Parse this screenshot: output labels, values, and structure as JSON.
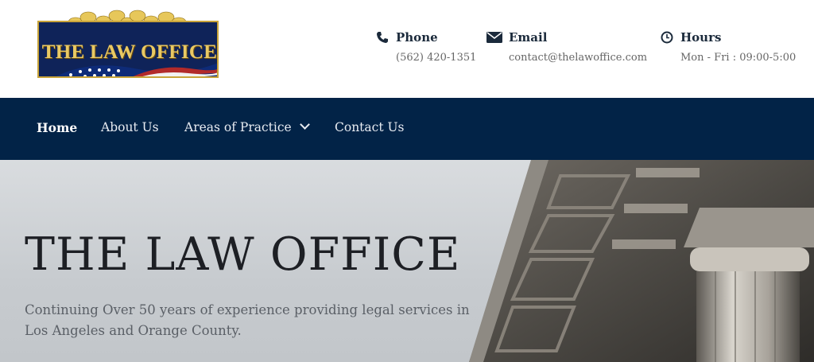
{
  "logo": {
    "text": "THE LAW OFFICE"
  },
  "contacts": {
    "phone": {
      "icon": "phone-icon",
      "label": "Phone",
      "value": "(562) 420-1351"
    },
    "email": {
      "icon": "envelope-icon",
      "label": "Email",
      "value": "contact@thelawoffice.com"
    },
    "hours": {
      "icon": "clock-icon",
      "label": "Hours",
      "value": "Mon - Fri : 09:00-5:00"
    }
  },
  "nav": {
    "items": [
      "Home",
      "About Us",
      "Areas of Practice",
      "Contact Us"
    ],
    "active": "Home"
  },
  "hero": {
    "title": "THE LAW OFFICE",
    "text": "Continuing Over 50 years of experience providing legal services in Los Angeles and Orange County."
  },
  "colors": {
    "nav_bg": "#022347",
    "logo_bg": "#0f2359",
    "logo_gold": "#e9c964"
  }
}
